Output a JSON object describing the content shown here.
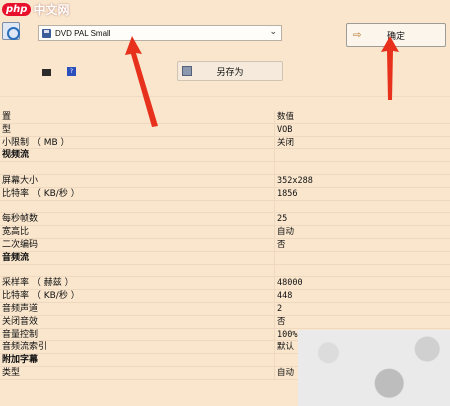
{
  "watermark": {
    "brand": "php",
    "site": "中文网"
  },
  "preset": {
    "selected": "DVD PAL Small"
  },
  "buttons": {
    "ok_label": "确定",
    "saveas_label": "另存为"
  },
  "icons": {
    "preset_disk": "dvd-disk-icon",
    "ok_arrow": "arrow-right-icon",
    "saveas": "floppy-save-icon",
    "mini1": "film-icon",
    "mini2": "help-icon"
  },
  "table": {
    "header": {
      "key": "置",
      "value": "数值"
    },
    "rows": [
      {
        "k": "型",
        "v": "VOB",
        "type": "normal"
      },
      {
        "k": "小限制 （ MB ）",
        "v": "关闭",
        "type": "normal"
      },
      {
        "k": "视频流",
        "v": "",
        "type": "section"
      },
      {
        "k": "",
        "v": "",
        "type": "disabled"
      },
      {
        "k": "屏幕大小",
        "v": "352x288",
        "type": "normal"
      },
      {
        "k": "比特率 （ KB/秒 ）",
        "v": "1856",
        "type": "normal"
      },
      {
        "k": "",
        "v": "",
        "type": "disabled"
      },
      {
        "k": "每秒帧数",
        "v": "25",
        "type": "normal"
      },
      {
        "k": "宽高比",
        "v": "自动",
        "type": "normal"
      },
      {
        "k": "二次编码",
        "v": "否",
        "type": "normal"
      },
      {
        "k": "音频流",
        "v": "",
        "type": "section"
      },
      {
        "k": "",
        "v": "",
        "type": "disabled"
      },
      {
        "k": "采样率 （ 赫兹 ）",
        "v": "48000",
        "type": "normal"
      },
      {
        "k": "比特率 （ KB/秒 ）",
        "v": "448",
        "type": "normal"
      },
      {
        "k": "音频声道",
        "v": "2",
        "type": "normal"
      },
      {
        "k": "关闭音效",
        "v": "否",
        "type": "normal"
      },
      {
        "k": "音量控制",
        "v": "100%",
        "type": "normal"
      },
      {
        "k": "音频流索引",
        "v": "默认",
        "type": "normal"
      },
      {
        "k": "附加字幕",
        "v": "",
        "type": "section"
      },
      {
        "k": "类型",
        "v": "自动",
        "type": "normal"
      }
    ]
  },
  "colors": {
    "background": "#f9e6cd",
    "annotation_arrow": "#e8311d",
    "php_badge": "#e8112d"
  }
}
